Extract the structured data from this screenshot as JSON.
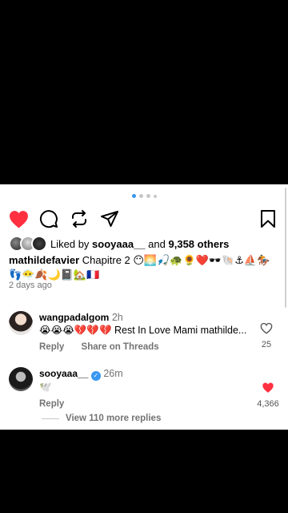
{
  "post": {
    "carousel": {
      "total": 4,
      "active": 0
    },
    "liked": true,
    "likes": {
      "prefix": "Liked by",
      "user": "sooyaaa__",
      "joiner": "and",
      "others": "9,358 others"
    },
    "caption": {
      "user": "mathildefavier",
      "text": "Chapitre 2 😶🌅🎣🐢🌻❤️🕶️🐚⚓⛵🏇👣😶‍🌫️🍂🌙📓🏡🇫🇷"
    },
    "date": "2 days ago"
  },
  "comments": [
    {
      "user": "wangpadalgom",
      "time": "2h",
      "text": "😭😭😭💔💔💔 Rest In Love Mami mathilde...",
      "reply_label": "Reply",
      "share_label": "Share on Threads",
      "like_count": "25",
      "liked": false
    },
    {
      "user": "sooyaaa__",
      "verified": true,
      "time": "26m",
      "text": "🕊️",
      "reply_label": "Reply",
      "like_count": "4,366",
      "liked": true
    }
  ],
  "view_more": "View 110 more replies",
  "colors": {
    "like_red": "#ff3040",
    "accent_blue": "#3897f0",
    "muted": "#737373"
  },
  "icons": [
    "heart-icon",
    "comment-icon",
    "repost-icon",
    "share-icon",
    "bookmark-icon"
  ]
}
